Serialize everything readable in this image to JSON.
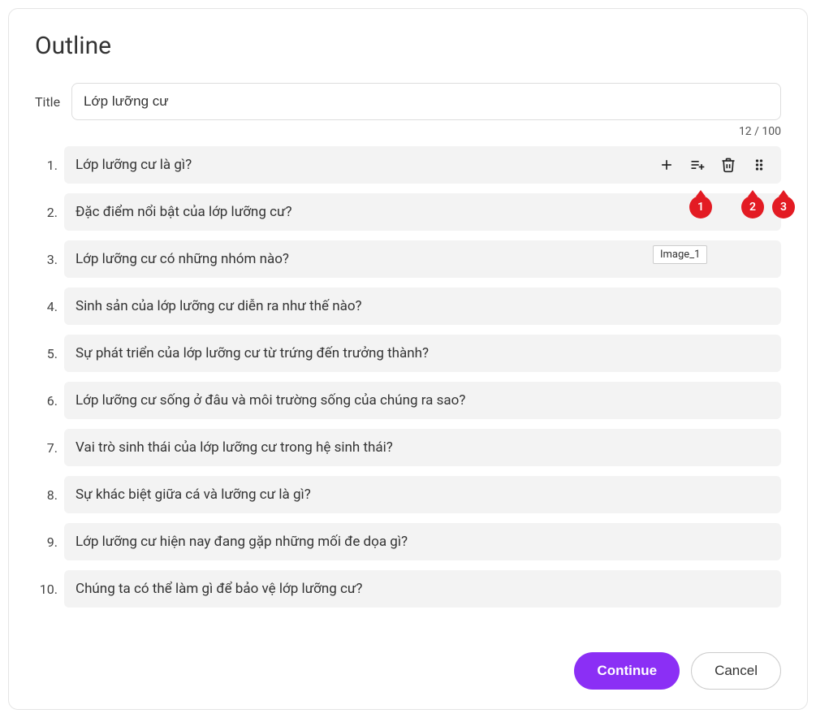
{
  "pageTitle": "Outline",
  "titleLabel": "Title",
  "titleValue": "Lớp lưỡng cư",
  "charCount": "12 / 100",
  "items": [
    {
      "number": "1.",
      "text": "Lớp lưỡng cư là gì?"
    },
    {
      "number": "2.",
      "text": "Đặc điểm nổi bật của lớp lưỡng cư?"
    },
    {
      "number": "3.",
      "text": "Lớp lưỡng cư có những nhóm nào?"
    },
    {
      "number": "4.",
      "text": "Sinh sản của lớp lưỡng cư diễn ra như thế nào?"
    },
    {
      "number": "5.",
      "text": "Sự phát triển của lớp lưỡng cư từ trứng đến trưởng thành?"
    },
    {
      "number": "6.",
      "text": "Lớp lưỡng cư sống ở đâu và môi trường sống của chúng ra sao?"
    },
    {
      "number": "7.",
      "text": "Vai trò sinh thái của lớp lưỡng cư trong hệ sinh thái?"
    },
    {
      "number": "8.",
      "text": "Sự khác biệt giữa cá và lưỡng cư là gì?"
    },
    {
      "number": "9.",
      "text": "Lớp lưỡng cư hiện nay đang gặp những mối đe dọa gì?"
    },
    {
      "number": "10.",
      "text": "Chúng ta có thể làm gì để bảo vệ lớp lưỡng cư?"
    }
  ],
  "callouts": {
    "c1": "1",
    "c2": "2",
    "c3": "3"
  },
  "tooltip": "Image_1",
  "buttons": {
    "continue": "Continue",
    "cancel": "Cancel"
  }
}
